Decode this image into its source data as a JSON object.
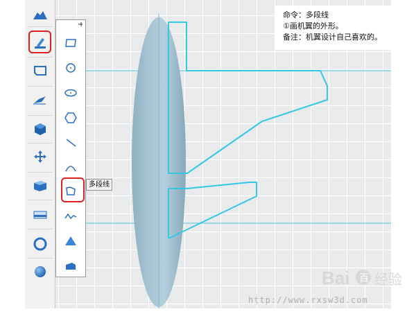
{
  "note": {
    "line1": "命令：多段线",
    "line2": "①画机翼的外形。",
    "line3": "备注：机翼设计自己喜欢的。"
  },
  "tooltip": {
    "label": "多段线"
  },
  "toolbar": {
    "items": [
      {
        "icon": "cloud-solid-icon"
      },
      {
        "icon": "sketch-pen-icon",
        "selected": true
      },
      {
        "icon": "panel-plane-icon"
      },
      {
        "icon": "paint-brush-icon"
      },
      {
        "icon": "cube-icon"
      },
      {
        "icon": "move-arrows-icon"
      },
      {
        "icon": "combine-box-icon"
      },
      {
        "icon": "inspect-bar-icon"
      },
      {
        "icon": "torus-icon"
      },
      {
        "icon": "sphere-icon"
      }
    ]
  },
  "sketch_tools": {
    "items": [
      {
        "icon": "rectangle-tool-icon"
      },
      {
        "icon": "circle-tool-icon"
      },
      {
        "icon": "ellipse-tool-icon"
      },
      {
        "icon": "polygon-tool-icon"
      },
      {
        "icon": "line-tool-icon"
      },
      {
        "icon": "arc-tool-icon"
      },
      {
        "icon": "polyline-tool-icon",
        "selected": true
      },
      {
        "icon": "spline-tool-icon"
      },
      {
        "icon": "projection-tool-icon"
      },
      {
        "icon": "offset-tool-icon"
      }
    ]
  },
  "watermark": {
    "brand": "Bai",
    "brand2": "百",
    "brand3": "经验",
    "url": "http://www.rxsw3d.com"
  },
  "colors": {
    "accent_red": "#e02020",
    "sketch_line": "#32c8e6",
    "fuselage": "#9fbfce"
  }
}
